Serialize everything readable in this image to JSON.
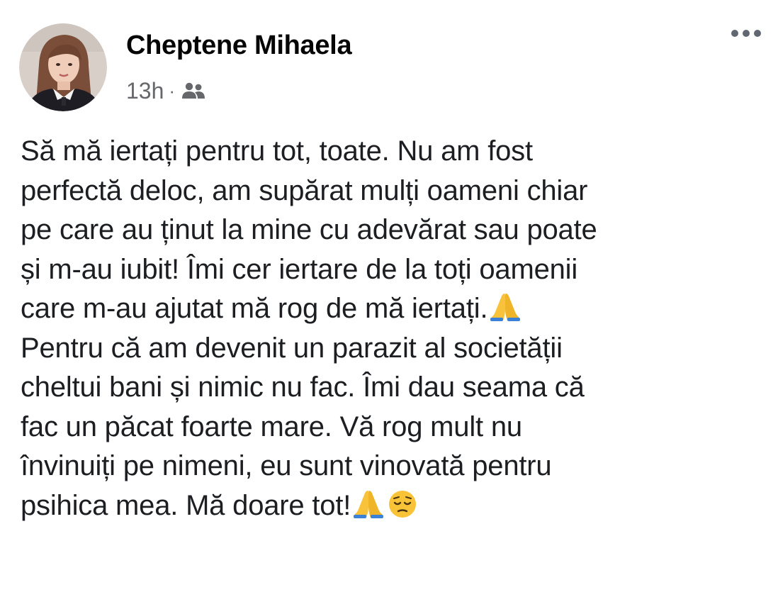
{
  "post": {
    "author": "Cheptene Mihaela",
    "time": "13h",
    "separator": "·",
    "audience_icon": "friends-icon",
    "more_icon": "more-options-icon",
    "text_lines": [
      "Să mă iertați pentru tot, toate. Nu am fost",
      "perfectă deloc, am supărat mulți oameni chiar",
      "pe care au ținut la mine cu adevărat sau poate",
      "și m-au iubit! Îmi cer iertare de la toți oamenii",
      "care m-au ajutat mă rog de mă iertați.",
      "Pentru că am devenit un parazit al societății",
      "cheltui bani și nimic nu fac. Îmi dau seama că",
      "fac un păcat foarte mare. Vă rog mult nu",
      "învinuiți pe nimeni, eu sunt vinovată pentru",
      "psihica mea. Mă doare tot!"
    ],
    "emojis": [
      "folded-hands",
      "folded-hands",
      "pensive-face"
    ]
  }
}
